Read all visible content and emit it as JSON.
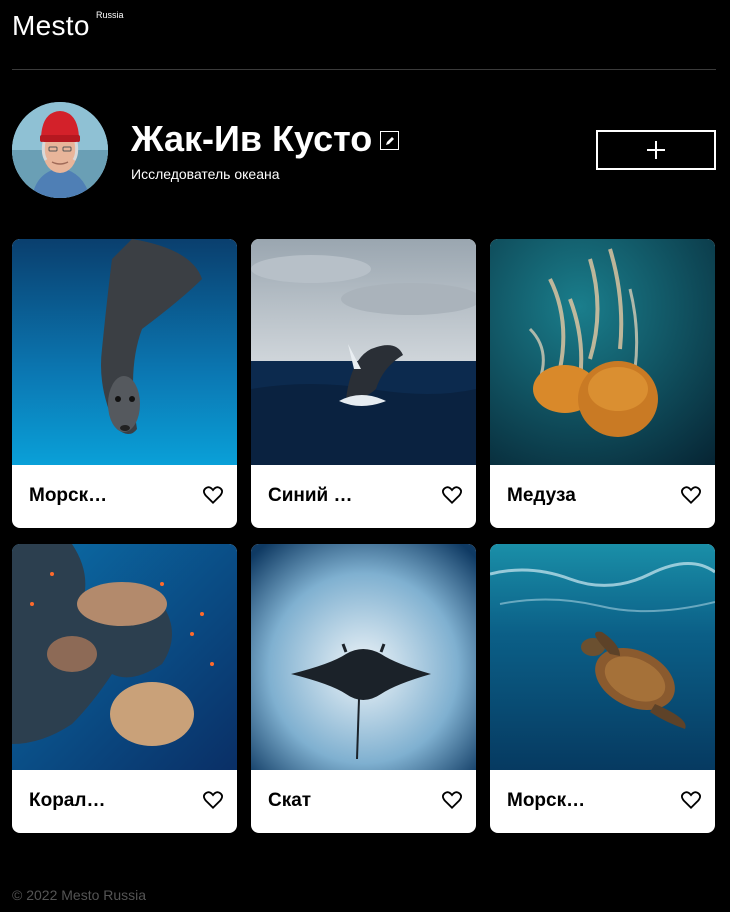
{
  "header": {
    "logo": "Mesto",
    "logo_sup": "Russia"
  },
  "profile": {
    "name": "Жак-Ив Кусто",
    "about": "Исследователь океана",
    "edit_icon": "pencil-icon",
    "add_icon": "plus-icon"
  },
  "cards": [
    {
      "title": "Морск…",
      "subject": "seal"
    },
    {
      "title": "Синий …",
      "subject": "whale"
    },
    {
      "title": "Медуза",
      "subject": "jellyfish"
    },
    {
      "title": "Корал…",
      "subject": "coral"
    },
    {
      "title": "Скат",
      "subject": "manta-ray"
    },
    {
      "title": "Морск…",
      "subject": "sea-turtle"
    }
  ],
  "like_icon": "heart-icon",
  "footer": {
    "copyright": "© 2022 Mesto Russia"
  }
}
